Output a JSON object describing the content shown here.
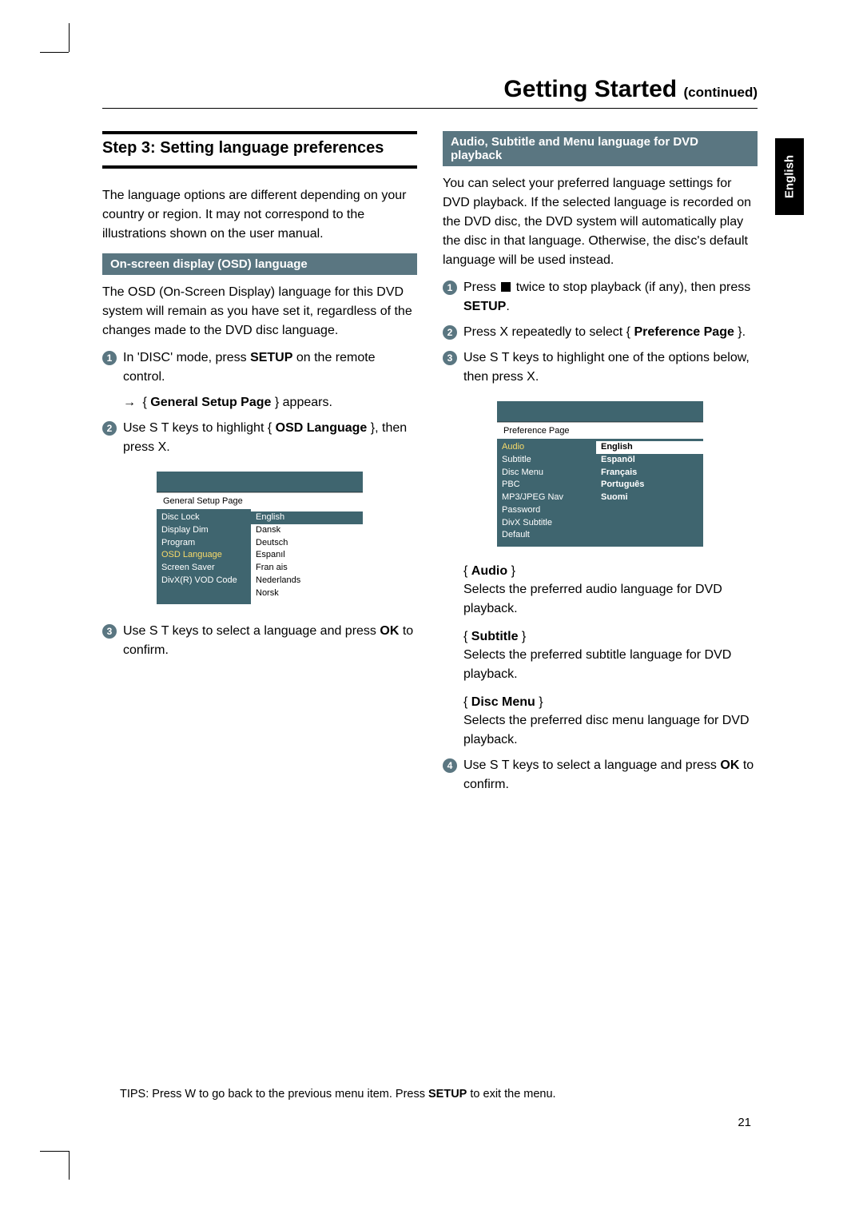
{
  "crop": {},
  "title": {
    "main": "Getting Started",
    "cont": "(continued)"
  },
  "langTab": "English",
  "left": {
    "stepHead": "Step 3:  Setting language preferences",
    "intro": "The language options are different depending on your country or region.  It may not correspond to the illustrations shown on the user manual.",
    "sub1": "On-screen display (OSD) language",
    "osdPara": "The OSD (On-Screen Display) language for this DVD system will remain as you have set it, regardless of the changes made to the DVD disc language.",
    "s1_a": "In 'DISC' mode, press ",
    "s1_b": "SETUP",
    "s1_c": " on the remote control.",
    "arrow1_a": "{ ",
    "arrow1_b": "General Setup Page",
    "arrow1_c": " } appears.",
    "s2_a": "Use  S T  keys to highlight { ",
    "s2_b": "OSD Language",
    "s2_c": " }, then press  X.",
    "s3_a": "Use  S T  keys to select a language and press ",
    "s3_b": "OK",
    "s3_c": " to confirm."
  },
  "osd1": {
    "title": "General Setup Page",
    "leftItems": [
      "Disc Lock",
      "Display Dim",
      "Program",
      "OSD Language",
      "Screen Saver",
      "DivX(R) VOD Code"
    ],
    "selectedLeft": "OSD Language",
    "rightItems": [
      "English",
      "Dansk",
      "Deutsch",
      "Espanıl",
      "Fran ais",
      "Nederlands",
      "Norsk"
    ],
    "selectedRight": "English"
  },
  "right": {
    "sub1": "Audio, Subtitle and Menu language for DVD playback",
    "p1": "You can select your preferred language settings for DVD playback.  If the selected language is recorded on the DVD disc, the DVD system will automatically play the disc in that language.  Otherwise, the disc's default language will be used instead.",
    "s1_a": "Press  ",
    "s1_b": "  twice to stop playback (if any), then press ",
    "s1_c": "SETUP",
    "s1_d": ".",
    "s2_a": "Press  X repeatedly to select { ",
    "s2_b": "Preference Page",
    "s2_c": " }.",
    "s3_a": "Use  S T  keys to highlight one of the options below, then press  X.",
    "optAudioL": "Audio",
    "optAudioD": "Selects the preferred audio language for DVD playback.",
    "optSubL": "Subtitle",
    "optSubD": "Selects the preferred subtitle language for DVD playback.",
    "optDiscL": "Disc Menu",
    "optDiscD": "Selects the preferred disc menu language for DVD playback.",
    "s4_a": "Use  S T  keys to select a language and press ",
    "s4_b": "OK",
    "s4_c": " to confirm."
  },
  "osd2": {
    "title": "Preference Page",
    "leftItems": [
      "Audio",
      "Subtitle",
      "Disc Menu",
      "PBC",
      "MP3/JPEG Nav",
      "Password",
      "DivX Subtitle",
      "Default"
    ],
    "selectedLeft": "Audio",
    "rightItems": [
      "English",
      "Espanöl",
      "Français",
      "Português",
      "Suomi"
    ],
    "selectedRight": "English"
  },
  "tips_a": "TIPS:  Press  W to go back to the previous menu item.  Press ",
  "tips_b": "SETUP",
  "tips_c": " to exit the menu.",
  "pageNum": "21"
}
